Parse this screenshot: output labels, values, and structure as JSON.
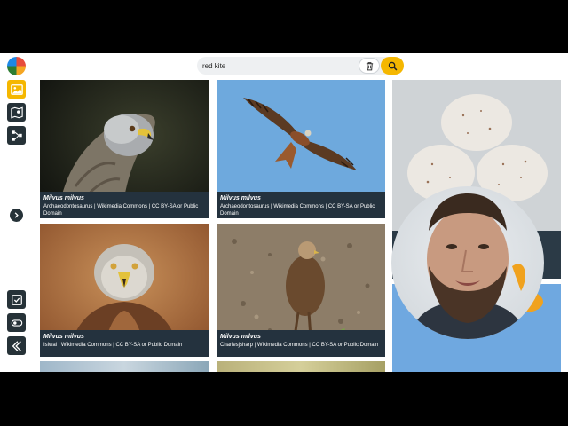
{
  "search": {
    "value": "red kite"
  },
  "sidebar": {
    "items": [
      {
        "name": "images-icon",
        "active": true
      },
      {
        "name": "map-icon",
        "active": false
      },
      {
        "name": "graph-icon",
        "active": false
      },
      {
        "name": "checklist-icon",
        "active": false
      },
      {
        "name": "toggle-icon",
        "active": false
      },
      {
        "name": "collapse-icon",
        "active": false
      }
    ]
  },
  "cards": [
    {
      "species": "Milvus milvus",
      "credit": "Archaeodontosaurus | Wikimedia Commons | CC BY-SA or Public Domain"
    },
    {
      "species": "Milvus milvus",
      "credit": "Archaeodontosaurus | Wikimedia Commons | CC BY-SA or Public Domain"
    },
    {
      "species": "Milvus milvus",
      "credit": "Isiwal | Wikimedia Commons | CC BY-SA or Public Domain"
    },
    {
      "species": "Milvus milvus",
      "credit": "Charlesjsharp | Wikimedia Commons | CC BY-SA or Public Domain"
    }
  ],
  "colors": {
    "accent": "#f5b700",
    "sidebar_button": "#263238",
    "caption_bg": "#24323e"
  }
}
